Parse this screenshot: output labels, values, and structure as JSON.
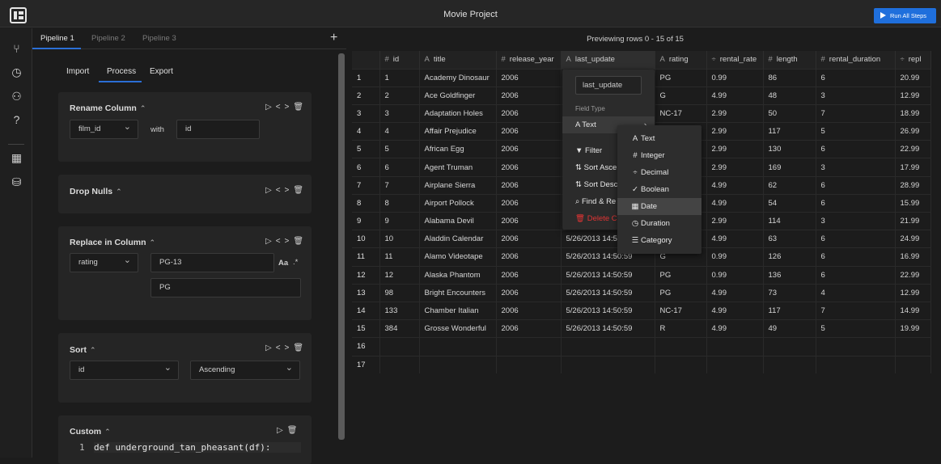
{
  "app": {
    "title": "Movie Project",
    "run_label": "Run All Steps"
  },
  "pipelines": {
    "tabs": [
      "Pipeline 1",
      "Pipeline 2",
      "Pipeline 3"
    ],
    "add": "+"
  },
  "subtabs": [
    "Import",
    "Process",
    "Export"
  ],
  "steps": {
    "rename": {
      "title": "Rename Column",
      "from": "film_id",
      "with_label": "with",
      "to": "id"
    },
    "dropnulls": {
      "title": "Drop Nulls"
    },
    "replace": {
      "title": "Replace in Column",
      "column": "rating",
      "find": "PG-13",
      "case_label": "Aa",
      "regex_label": ".*",
      "replace": "PG"
    },
    "sort": {
      "title": "Sort",
      "column": "id",
      "order": "Ascending"
    },
    "custom": {
      "title": "Custom",
      "line_no": "1",
      "code": "def underground_tan_pheasant(df):"
    }
  },
  "grid": {
    "preview": "Previewing rows 0 - 15 of 15",
    "columns": [
      {
        "type": "#",
        "name": "id"
      },
      {
        "type": "A",
        "name": "title"
      },
      {
        "type": "#",
        "name": "release_year"
      },
      {
        "type": "A",
        "name": "last_update"
      },
      {
        "type": "A",
        "name": "rating"
      },
      {
        "type": "÷",
        "name": "rental_rate"
      },
      {
        "type": "#",
        "name": "length"
      },
      {
        "type": "#",
        "name": "rental_duration"
      },
      {
        "type": "÷",
        "name": "repl"
      }
    ],
    "rows": [
      [
        "1",
        "1",
        "Academy Dinosaur",
        "2006",
        "",
        "PG",
        "0.99",
        "86",
        "6",
        "20.99"
      ],
      [
        "2",
        "2",
        "Ace Goldfinger",
        "2006",
        "",
        "G",
        "4.99",
        "48",
        "3",
        "12.99"
      ],
      [
        "3",
        "3",
        "Adaptation Holes",
        "2006",
        "",
        "NC-17",
        "2.99",
        "50",
        "7",
        "18.99"
      ],
      [
        "4",
        "4",
        "Affair Prejudice",
        "2006",
        "",
        "G",
        "2.99",
        "117",
        "5",
        "26.99"
      ],
      [
        "5",
        "5",
        "African Egg",
        "2006",
        "",
        "G",
        "2.99",
        "130",
        "6",
        "22.99"
      ],
      [
        "6",
        "6",
        "Agent Truman",
        "2006",
        "",
        "PG",
        "2.99",
        "169",
        "3",
        "17.99"
      ],
      [
        "7",
        "7",
        "Airplane Sierra",
        "2006",
        "",
        "PG-13",
        "4.99",
        "62",
        "6",
        "28.99"
      ],
      [
        "8",
        "8",
        "Airport Pollock",
        "2006",
        "",
        "R",
        "4.99",
        "54",
        "6",
        "15.99"
      ],
      [
        "9",
        "9",
        "Alabama Devil",
        "2006",
        "",
        "PG-13",
        "2.99",
        "114",
        "3",
        "21.99"
      ],
      [
        "10",
        "10",
        "Aladdin Calendar",
        "2006",
        "5/26/2013 14:50:",
        "NC-17",
        "4.99",
        "63",
        "6",
        "24.99"
      ],
      [
        "11",
        "11",
        "Alamo Videotape",
        "2006",
        "5/26/2013 14:50:59",
        "G",
        "0.99",
        "126",
        "6",
        "16.99"
      ],
      [
        "12",
        "12",
        "Alaska Phantom",
        "2006",
        "5/26/2013 14:50:59",
        "PG",
        "0.99",
        "136",
        "6",
        "22.99"
      ],
      [
        "13",
        "98",
        "Bright Encounters",
        "2006",
        "5/26/2013 14:50:59",
        "PG",
        "4.99",
        "73",
        "4",
        "12.99"
      ],
      [
        "14",
        "133",
        "Chamber Italian",
        "2006",
        "5/26/2013 14:50:59",
        "NC-17",
        "4.99",
        "117",
        "7",
        "14.99"
      ],
      [
        "15",
        "384",
        "Grosse Wonderful",
        "2006",
        "5/26/2013 14:50:59",
        "R",
        "4.99",
        "49",
        "5",
        "19.99"
      ],
      [
        "16",
        "",
        "",
        "",
        "",
        "",
        "",
        "",
        "",
        ""
      ],
      [
        "17",
        "",
        "",
        "",
        "",
        "",
        "",
        "",
        "",
        ""
      ]
    ]
  },
  "context_menu": {
    "rename_value": "last_update",
    "field_type_label": "Field Type",
    "current_type": "Text",
    "items": [
      "Filter",
      "Sort Asce",
      "Sort Desc",
      "Find & Re",
      "Delete Co"
    ],
    "types": [
      "Text",
      "Integer",
      "Decimal",
      "Boolean",
      "Date",
      "Duration",
      "Category"
    ]
  }
}
